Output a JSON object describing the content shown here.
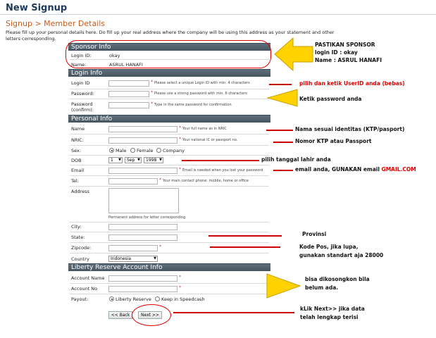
{
  "header": {
    "title": "New Signup",
    "breadcrumb": "Signup > Member Details",
    "intro": "Please fill up your personal details here. Do fill up your real address where the company will be using this address as your statement and other letters corresponding."
  },
  "sponsor": {
    "heading": "Sponsor Info",
    "login_label": "Login ID:",
    "login_value": "okay",
    "name_label": "Name:",
    "name_value": "ASRUL HANAFI"
  },
  "login": {
    "heading": "Login Info",
    "login_id_label": "Login ID",
    "login_id_hint": "Please select a unique Login ID with min. 4 characters",
    "password_label": "Password:",
    "password_hint": "Please use a strong password with min. 6 characters",
    "confirm_label_1": "Password",
    "confirm_label_2": "(confirm):",
    "confirm_hint": "Type in the same password for confirmation"
  },
  "personal": {
    "heading": "Personal Info",
    "name_label": "Name",
    "name_hint": "Your full name as in NRIC",
    "nric_label": "NRIC:",
    "nric_hint": "Your national IC or passport no.",
    "sex_label": "Sex:",
    "sex_options": [
      "Male",
      "Female",
      "Company"
    ],
    "sex_selected": "Male",
    "dob_label": "DOB",
    "dob_day": "1",
    "dob_month": "Sep",
    "dob_year": "1998",
    "email_label": "Email",
    "email_hint": "Email is needed when you lost your password",
    "tel_label": "Tel:",
    "tel_hint": "Your main contact phone: mobile, home or office",
    "address_label": "Address",
    "address_hint": "Permanent address for letter corresponding",
    "city_label": "City:",
    "state_label": "State:",
    "zipcode_label": "Zipcode:",
    "country_label": "Country",
    "country_value": "Indonesia"
  },
  "liberty": {
    "heading": "Liberty Reserve Account Info",
    "account_name_label": "Account Name",
    "account_no_label": "Account No",
    "payout_label": "Payout:",
    "payout_options": [
      "Liberty Reserve",
      "Keep in Speedcash"
    ],
    "payout_selected": "Liberty Reserve"
  },
  "buttons": {
    "back": "<< Back",
    "next": "Next >>"
  },
  "annotations": {
    "sponsor_1": "PASTIKAN SPONSOR",
    "sponsor_2": "login ID : okay",
    "sponsor_3": "Name : ASRUL HANAFI",
    "userid": "pilih dan ketik UserID anda (bebas)",
    "password": "Ketik password anda",
    "name": "Nama sesuai identitas (KTP/pasport)",
    "nric": "Nomor KTP atau Passport",
    "dob": "pilih tanggal lahir anda",
    "email_prefix": "email anda, GUNAKAN email ",
    "email_brand": "GMAIL.COM",
    "province": "Provinsi",
    "zip_1": "Kode Pos, jika lupa,",
    "zip_2": "gunakan standart aja 28000",
    "liberty_1": "bisa dikosongkon bila",
    "liberty_2": "belum ada.",
    "next_1": "kLik Next>> jika data",
    "next_2": "telah lengkap terisi"
  },
  "colors": {
    "section_bar": "#4d5d6a",
    "header_title": "#1d3a5c",
    "breadcrumb": "#d05a1a",
    "annotation_red": "#e00000",
    "arrow_yellow": "#ffd200"
  }
}
